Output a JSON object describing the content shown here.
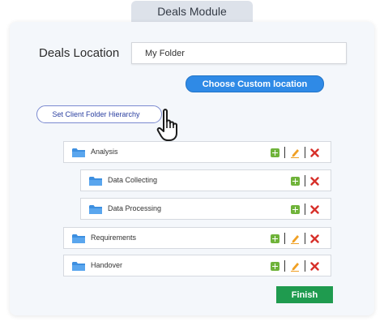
{
  "module": {
    "tab_label": "Deals Module"
  },
  "location": {
    "label": "Deals Location",
    "value": "My Folder",
    "choose_button": "Choose Custom location"
  },
  "hierarchy_button": "Set Client Folder Hierarchy",
  "folders": [
    {
      "label": "Analysis",
      "level": 0
    },
    {
      "label": "Data Collecting",
      "level": 1
    },
    {
      "label": "Data Processing",
      "level": 1
    },
    {
      "label": "Requirements",
      "level": 0
    },
    {
      "label": "Handover",
      "level": 0
    }
  ],
  "finish_button": "Finish",
  "icons": {
    "folder": "folder-icon",
    "add": "add-icon",
    "edit": "edit-pencil-icon",
    "delete": "delete-x-icon",
    "cursor": "hand-pointer-icon"
  },
  "colors": {
    "accent_blue": "#2f8ae6",
    "finish_green": "#1f9b4f",
    "add_green": "#6fb33a",
    "edit_orange": "#f0a024",
    "delete_red": "#d7302a",
    "folder_blue": "#3d8fe0"
  }
}
